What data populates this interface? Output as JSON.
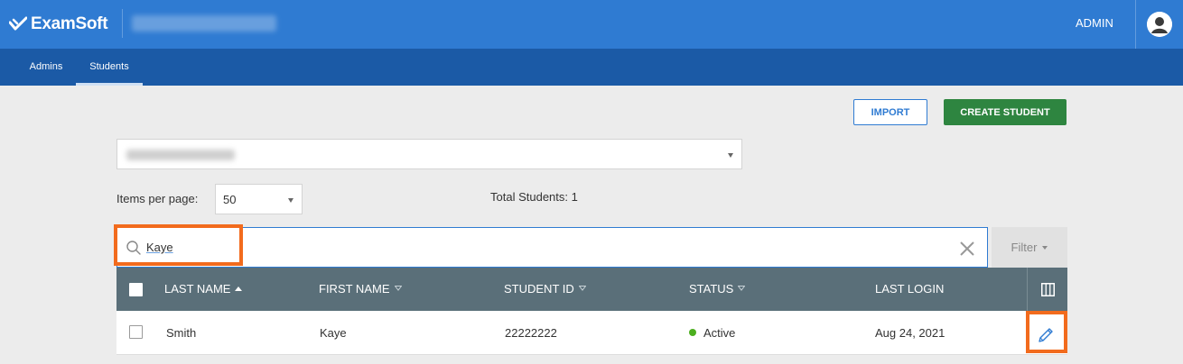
{
  "header": {
    "logo_text": "ExamSoft",
    "user_label": "ADMIN"
  },
  "subnav": {
    "tabs": [
      {
        "label": "Admins",
        "active": false
      },
      {
        "label": "Students",
        "active": true
      }
    ]
  },
  "actions": {
    "import_label": "IMPORT",
    "create_label": "CREATE STUDENT"
  },
  "department": {
    "selected": ""
  },
  "pagination": {
    "items_per_page_label": "Items per page:",
    "items_per_page_value": "50",
    "total_label": "Total Students: 1"
  },
  "search": {
    "value": "Kaye",
    "filter_label": "Filter"
  },
  "table": {
    "columns": [
      {
        "label": "LAST NAME",
        "sort": "ascending"
      },
      {
        "label": "FIRST NAME",
        "sort": "none"
      },
      {
        "label": "STUDENT ID",
        "sort": "none"
      },
      {
        "label": "STATUS",
        "sort": "none"
      },
      {
        "label": "LAST LOGIN",
        "sort": "none"
      }
    ],
    "rows": [
      {
        "last_name": "Smith",
        "first_name": "Kaye",
        "student_id": "22222222",
        "status": "Active",
        "last_login": "Aug 24, 2021"
      }
    ]
  },
  "colors": {
    "header_blue": "#2f7bd2",
    "subnav_blue": "#1b5aa6",
    "create_green": "#2e8540",
    "table_header": "#5a6f79",
    "highlight_orange": "#f26b1d",
    "status_active": "#4caf1f"
  },
  "icons": {
    "logo": "examsoft-check-logo-icon",
    "avatar": "user-avatar-icon",
    "search": "search-icon",
    "clear": "close-x-icon",
    "columns": "columns-icon",
    "edit": "pencil-edit-icon"
  }
}
